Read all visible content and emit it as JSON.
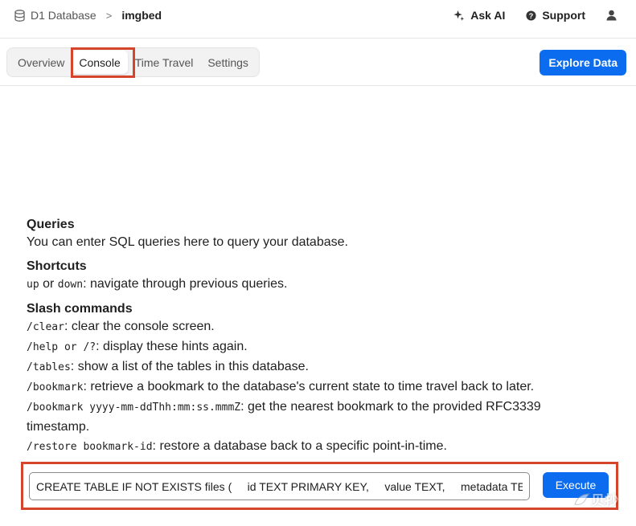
{
  "header": {
    "breadcrumb": {
      "database_label": "D1 Database",
      "separator": ">",
      "current": "imgbed"
    },
    "ask_ai_label": "Ask AI",
    "support_label": "Support",
    "icons": {
      "database": "database-icon",
      "sparkle": "sparkle-icon",
      "help": "help-circle-icon",
      "user": "user-icon"
    }
  },
  "tabs": [
    {
      "label": "Overview",
      "active": false
    },
    {
      "label": "Console",
      "active": true
    },
    {
      "label": "Time Travel",
      "active": false
    },
    {
      "label": "Settings",
      "active": false
    }
  ],
  "explore_button_label": "Explore Data",
  "help": {
    "queries": {
      "title": "Queries",
      "text": "You can enter SQL queries here to query your database."
    },
    "shortcuts": {
      "title": "Shortcuts",
      "up": "up",
      "or": " or ",
      "down": "down",
      "text": ": navigate through previous queries."
    },
    "slash": {
      "title": "Slash commands",
      "clear_cmd": "/clear",
      "clear_text": ": clear the console screen.",
      "help_cmd": "/help or /?",
      "help_text": ": display these hints again.",
      "tables_cmd": "/tables",
      "tables_text": ": show a list of the tables in this database.",
      "bookmark_cmd": "/bookmark",
      "bookmark_text": ": retrieve a bookmark to the database's current state to time travel back to later.",
      "bookmark_ts_cmd": "/bookmark yyyy-mm-ddThh:mm:ss.mmmZ",
      "bookmark_ts_text": ": get the nearest bookmark to the provided RFC3339 timestamp.",
      "restore_cmd": "/restore bookmark-id",
      "restore_text": ": restore a database back to a specific point-in-time."
    }
  },
  "console": {
    "input_value": "CREATE TABLE IF NOT EXISTS files (     id TEXT PRIMARY KEY,     value TEXT,     metadata TEXT",
    "execute_label": "Execute"
  },
  "watermark": {
    "text": "贝抄"
  },
  "colors": {
    "accent": "#0b6cf0",
    "highlight": "#d4452b"
  }
}
